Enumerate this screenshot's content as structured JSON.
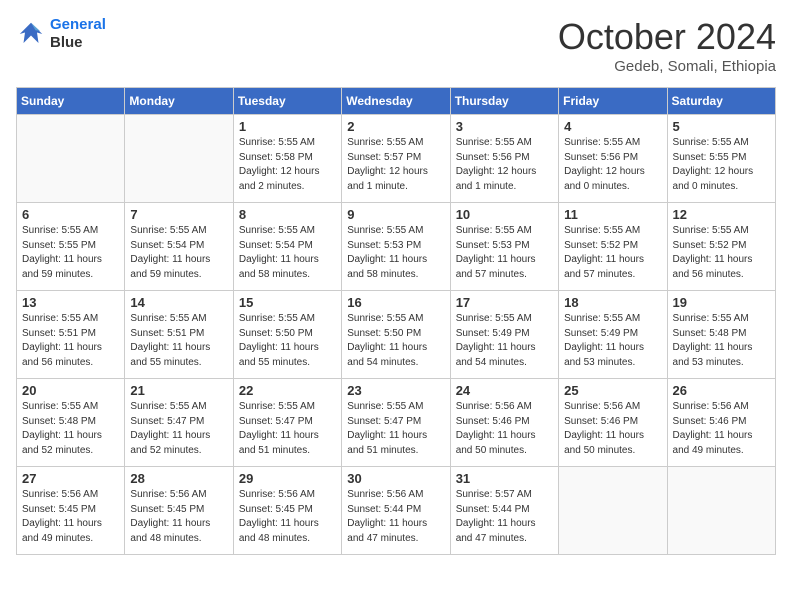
{
  "logo": {
    "line1": "General",
    "line2": "Blue"
  },
  "title": "October 2024",
  "location": "Gedeb, Somali, Ethiopia",
  "days_header": [
    "Sunday",
    "Monday",
    "Tuesday",
    "Wednesday",
    "Thursday",
    "Friday",
    "Saturday"
  ],
  "weeks": [
    [
      {
        "day": "",
        "info": ""
      },
      {
        "day": "",
        "info": ""
      },
      {
        "day": "1",
        "info": "Sunrise: 5:55 AM\nSunset: 5:58 PM\nDaylight: 12 hours\nand 2 minutes."
      },
      {
        "day": "2",
        "info": "Sunrise: 5:55 AM\nSunset: 5:57 PM\nDaylight: 12 hours\nand 1 minute."
      },
      {
        "day": "3",
        "info": "Sunrise: 5:55 AM\nSunset: 5:56 PM\nDaylight: 12 hours\nand 1 minute."
      },
      {
        "day": "4",
        "info": "Sunrise: 5:55 AM\nSunset: 5:56 PM\nDaylight: 12 hours\nand 0 minutes."
      },
      {
        "day": "5",
        "info": "Sunrise: 5:55 AM\nSunset: 5:55 PM\nDaylight: 12 hours\nand 0 minutes."
      }
    ],
    [
      {
        "day": "6",
        "info": "Sunrise: 5:55 AM\nSunset: 5:55 PM\nDaylight: 11 hours\nand 59 minutes."
      },
      {
        "day": "7",
        "info": "Sunrise: 5:55 AM\nSunset: 5:54 PM\nDaylight: 11 hours\nand 59 minutes."
      },
      {
        "day": "8",
        "info": "Sunrise: 5:55 AM\nSunset: 5:54 PM\nDaylight: 11 hours\nand 58 minutes."
      },
      {
        "day": "9",
        "info": "Sunrise: 5:55 AM\nSunset: 5:53 PM\nDaylight: 11 hours\nand 58 minutes."
      },
      {
        "day": "10",
        "info": "Sunrise: 5:55 AM\nSunset: 5:53 PM\nDaylight: 11 hours\nand 57 minutes."
      },
      {
        "day": "11",
        "info": "Sunrise: 5:55 AM\nSunset: 5:52 PM\nDaylight: 11 hours\nand 57 minutes."
      },
      {
        "day": "12",
        "info": "Sunrise: 5:55 AM\nSunset: 5:52 PM\nDaylight: 11 hours\nand 56 minutes."
      }
    ],
    [
      {
        "day": "13",
        "info": "Sunrise: 5:55 AM\nSunset: 5:51 PM\nDaylight: 11 hours\nand 56 minutes."
      },
      {
        "day": "14",
        "info": "Sunrise: 5:55 AM\nSunset: 5:51 PM\nDaylight: 11 hours\nand 55 minutes."
      },
      {
        "day": "15",
        "info": "Sunrise: 5:55 AM\nSunset: 5:50 PM\nDaylight: 11 hours\nand 55 minutes."
      },
      {
        "day": "16",
        "info": "Sunrise: 5:55 AM\nSunset: 5:50 PM\nDaylight: 11 hours\nand 54 minutes."
      },
      {
        "day": "17",
        "info": "Sunrise: 5:55 AM\nSunset: 5:49 PM\nDaylight: 11 hours\nand 54 minutes."
      },
      {
        "day": "18",
        "info": "Sunrise: 5:55 AM\nSunset: 5:49 PM\nDaylight: 11 hours\nand 53 minutes."
      },
      {
        "day": "19",
        "info": "Sunrise: 5:55 AM\nSunset: 5:48 PM\nDaylight: 11 hours\nand 53 minutes."
      }
    ],
    [
      {
        "day": "20",
        "info": "Sunrise: 5:55 AM\nSunset: 5:48 PM\nDaylight: 11 hours\nand 52 minutes."
      },
      {
        "day": "21",
        "info": "Sunrise: 5:55 AM\nSunset: 5:47 PM\nDaylight: 11 hours\nand 52 minutes."
      },
      {
        "day": "22",
        "info": "Sunrise: 5:55 AM\nSunset: 5:47 PM\nDaylight: 11 hours\nand 51 minutes."
      },
      {
        "day": "23",
        "info": "Sunrise: 5:55 AM\nSunset: 5:47 PM\nDaylight: 11 hours\nand 51 minutes."
      },
      {
        "day": "24",
        "info": "Sunrise: 5:56 AM\nSunset: 5:46 PM\nDaylight: 11 hours\nand 50 minutes."
      },
      {
        "day": "25",
        "info": "Sunrise: 5:56 AM\nSunset: 5:46 PM\nDaylight: 11 hours\nand 50 minutes."
      },
      {
        "day": "26",
        "info": "Sunrise: 5:56 AM\nSunset: 5:46 PM\nDaylight: 11 hours\nand 49 minutes."
      }
    ],
    [
      {
        "day": "27",
        "info": "Sunrise: 5:56 AM\nSunset: 5:45 PM\nDaylight: 11 hours\nand 49 minutes."
      },
      {
        "day": "28",
        "info": "Sunrise: 5:56 AM\nSunset: 5:45 PM\nDaylight: 11 hours\nand 48 minutes."
      },
      {
        "day": "29",
        "info": "Sunrise: 5:56 AM\nSunset: 5:45 PM\nDaylight: 11 hours\nand 48 minutes."
      },
      {
        "day": "30",
        "info": "Sunrise: 5:56 AM\nSunset: 5:44 PM\nDaylight: 11 hours\nand 47 minutes."
      },
      {
        "day": "31",
        "info": "Sunrise: 5:57 AM\nSunset: 5:44 PM\nDaylight: 11 hours\nand 47 minutes."
      },
      {
        "day": "",
        "info": ""
      },
      {
        "day": "",
        "info": ""
      }
    ]
  ]
}
